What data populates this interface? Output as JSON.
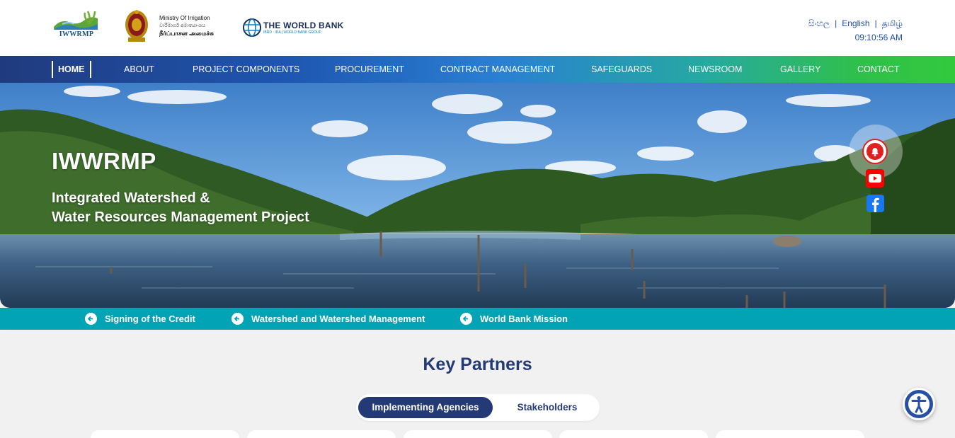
{
  "header": {
    "logo_text": "IWWRMP",
    "ministry_line1": "Ministry Of Irrigation",
    "ministry_line2": "වාරිමාර්ග අමාත්‍යාංශය",
    "ministry_line3": "நீர்ப்பாசன அமைச்சு",
    "worldbank_title": "THE WORLD BANK",
    "worldbank_sub": "IBRD · IDA | WORLD BANK GROUP",
    "languages": [
      "සිංහල",
      "English",
      "தமிழ்"
    ],
    "time": "09:10:56 AM"
  },
  "nav": {
    "items": [
      {
        "label": "HOME",
        "active": true
      },
      {
        "label": "ABOUT"
      },
      {
        "label": "PROJECT COMPONENTS"
      },
      {
        "label": "PROCUREMENT"
      },
      {
        "label": "CONTRACT MANAGEMENT"
      },
      {
        "label": "SAFEGUARDS"
      },
      {
        "label": "NEWSROOM"
      },
      {
        "label": "GALLERY"
      },
      {
        "label": "CONTACT"
      }
    ]
  },
  "hero": {
    "title": "IWWRMP",
    "subtitle_line1": "Integrated Watershed &",
    "subtitle_line2": "Water Resources Management Project",
    "social_icons": [
      "bell-icon",
      "youtube-icon",
      "facebook-icon"
    ]
  },
  "ticker": {
    "items": [
      "Signing of the Credit",
      "Watershed and Watershed Management",
      "World Bank Mission"
    ]
  },
  "main": {
    "section_title": "Key Partners",
    "tabs": [
      {
        "label": "Implementing Agencies",
        "selected": true
      },
      {
        "label": "Stakeholders",
        "selected": false
      }
    ]
  },
  "colors": {
    "primary_navy": "#243a76",
    "teal_ticker": "#02a3b5",
    "nav_start": "#203a7e",
    "nav_end": "#33c93d",
    "link_blue": "#1f4ea3"
  }
}
